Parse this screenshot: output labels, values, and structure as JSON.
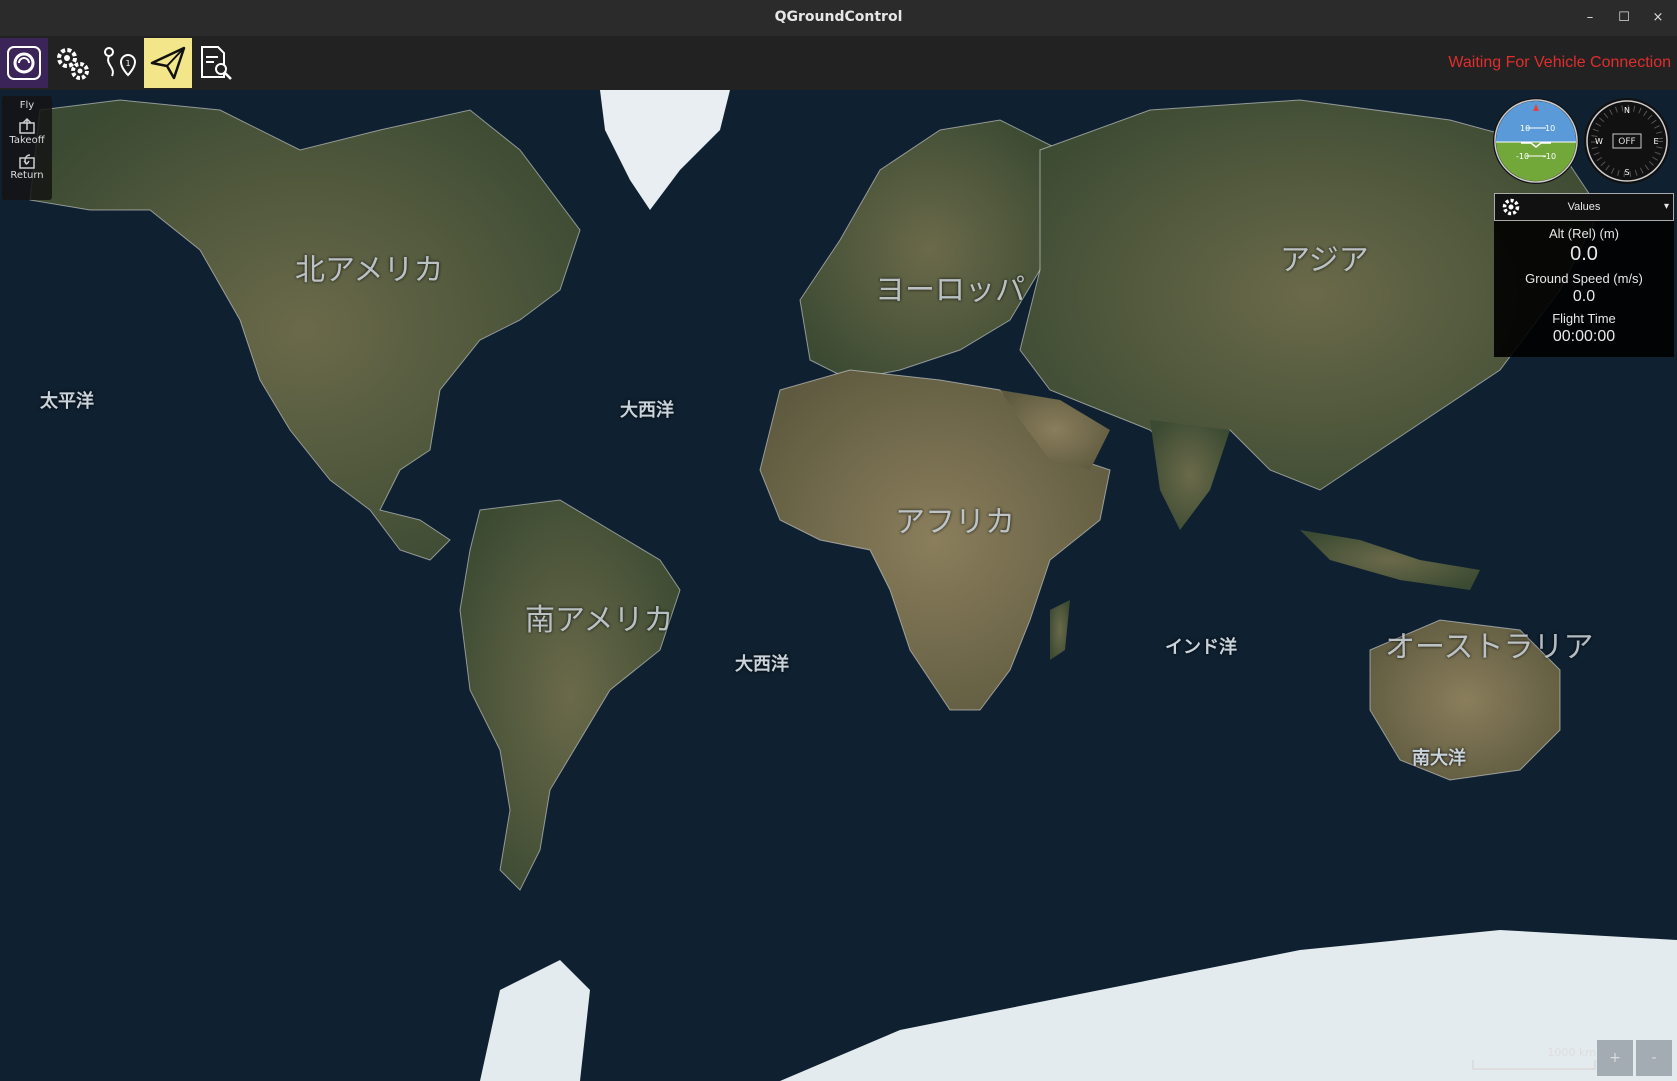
{
  "window": {
    "title": "QGroundControl",
    "minimize": "–",
    "maximize": "☐",
    "close": "×"
  },
  "toolbar": {
    "buttons": [
      {
        "name": "qgc-logo-icon"
      },
      {
        "name": "settings-gears-icon"
      },
      {
        "name": "plan-route-icon"
      },
      {
        "name": "fly-paper-plane-icon",
        "active": true
      },
      {
        "name": "analyze-document-icon"
      }
    ],
    "status": "Waiting For Vehicle Connection"
  },
  "fly_tools": {
    "header": "Fly",
    "takeoff": "Takeoff",
    "return": "Return"
  },
  "instruments": {
    "attitude": {
      "t1": "10",
      "t2": "10",
      "t3": "-10",
      "t4": "-10"
    },
    "compass": {
      "n": "N",
      "e": "E",
      "s": "S",
      "w": "W",
      "mode": "OFF"
    }
  },
  "values_panel": {
    "header": "Values",
    "alt_label": "Alt (Rel) (m)",
    "alt_value": "0.0",
    "speed_label": "Ground Speed (m/s)",
    "speed_value": "0.0",
    "time_label": "Flight Time",
    "time_value": "00:00:00"
  },
  "map_labels": {
    "north_america": "北アメリカ",
    "europe": "ヨーロッパ",
    "asia": "アジア",
    "africa": "アフリカ",
    "south_america": "南アメリカ",
    "australia": "オーストラリア",
    "pacific": "太平洋",
    "atlantic_north": "大西洋",
    "atlantic_south": "大西洋",
    "indian": "インド洋",
    "southern": "南大洋"
  },
  "scale": {
    "label": "1000 km"
  },
  "zoom": {
    "in": "+",
    "out": "-"
  },
  "colors": {
    "status": "#e02d2d",
    "active_tool": "#f3e58a",
    "ocean": "#0c1a27"
  }
}
